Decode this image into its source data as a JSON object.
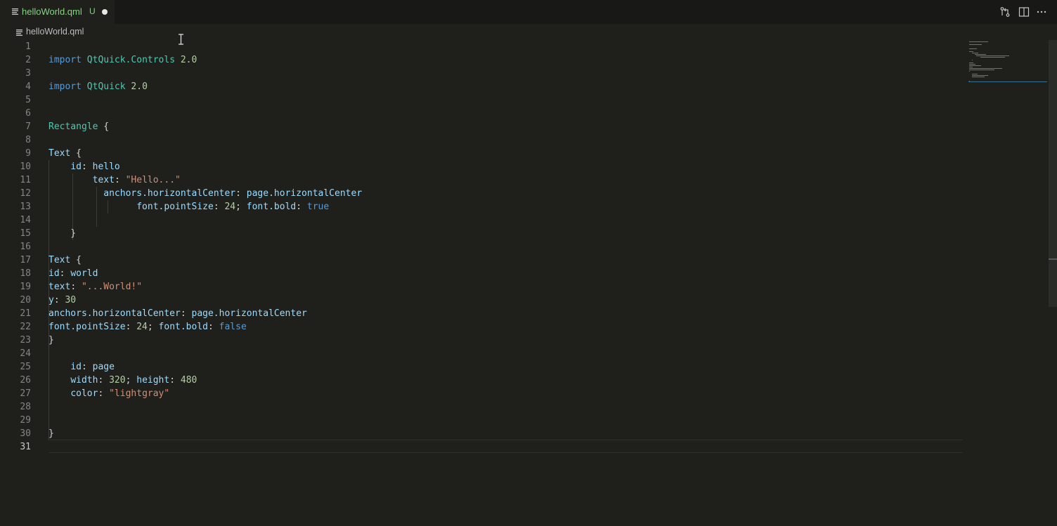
{
  "tab": {
    "filename": "helloWorld.qml",
    "status": "U"
  },
  "breadcrumb": {
    "filename": "helloWorld.qml"
  },
  "editor": {
    "current_line": 31,
    "lines": [
      {
        "n": "1",
        "text": ""
      },
      {
        "n": "2",
        "text": "import QtQuick.Controls 2.0"
      },
      {
        "n": "3",
        "text": ""
      },
      {
        "n": "4",
        "text": "import QtQuick 2.0"
      },
      {
        "n": "5",
        "text": ""
      },
      {
        "n": "6",
        "text": ""
      },
      {
        "n": "7",
        "text": "Rectangle {"
      },
      {
        "n": "8",
        "text": ""
      },
      {
        "n": "9",
        "text": "Text {"
      },
      {
        "n": "10",
        "text": "    id: hello"
      },
      {
        "n": "11",
        "text": "        text: \"Hello...\""
      },
      {
        "n": "12",
        "text": "          anchors.horizontalCenter: page.horizontalCenter"
      },
      {
        "n": "13",
        "text": "                font.pointSize: 24; font.bold: true"
      },
      {
        "n": "14",
        "text": ""
      },
      {
        "n": "15",
        "text": "    }"
      },
      {
        "n": "16",
        "text": ""
      },
      {
        "n": "17",
        "text": "Text {"
      },
      {
        "n": "18",
        "text": "id: world"
      },
      {
        "n": "19",
        "text": "text: \"...World!\""
      },
      {
        "n": "20",
        "text": "y: 30"
      },
      {
        "n": "21",
        "text": "anchors.horizontalCenter: page.horizontalCenter"
      },
      {
        "n": "22",
        "text": "font.pointSize: 24; font.bold: false"
      },
      {
        "n": "23",
        "text": "}"
      },
      {
        "n": "24",
        "text": ""
      },
      {
        "n": "25",
        "text": "    id: page"
      },
      {
        "n": "26",
        "text": "    width: 320; height: 480"
      },
      {
        "n": "27",
        "text": "    color: \"lightgray\""
      },
      {
        "n": "28",
        "text": ""
      },
      {
        "n": "29",
        "text": ""
      },
      {
        "n": "30",
        "text": "}"
      },
      {
        "n": "31",
        "text": ""
      }
    ]
  },
  "actions": [
    {
      "name": "open-changes-icon"
    },
    {
      "name": "split-editor-icon"
    },
    {
      "name": "more-actions-icon"
    }
  ],
  "colors": {
    "background": "#1f1f1c",
    "tab_text": "#89d185",
    "keyword": "#569cd6",
    "type": "#4ec9b0",
    "number": "#b5cea8",
    "string": "#ce9178",
    "property": "#9cdcfe"
  }
}
